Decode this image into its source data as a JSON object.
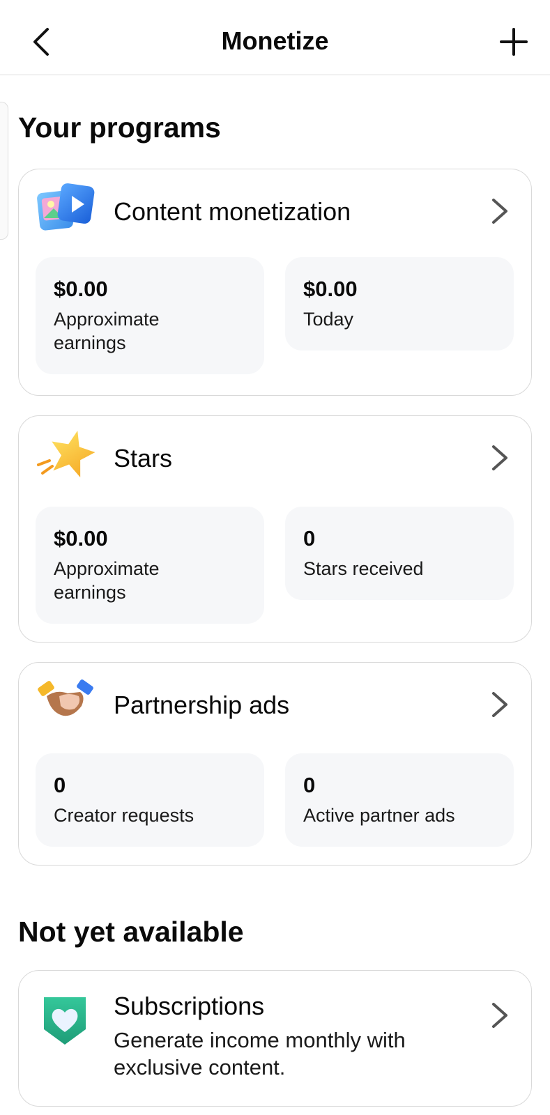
{
  "header": {
    "title": "Monetize"
  },
  "your_programs": {
    "title": "Your programs",
    "cards": [
      {
        "name": "Content monetization",
        "icon": "photo-video-icon",
        "stats": [
          {
            "value": "$0.00",
            "label": "Approximate earnings"
          },
          {
            "value": "$0.00",
            "label": "Today"
          }
        ]
      },
      {
        "name": "Stars",
        "icon": "star-icon",
        "stats": [
          {
            "value": "$0.00",
            "label": "Approximate earnings"
          },
          {
            "value": "0",
            "label": "Stars received"
          }
        ]
      },
      {
        "name": "Partnership ads",
        "icon": "handshake-icon",
        "stats": [
          {
            "value": "0",
            "label": "Creator requests"
          },
          {
            "value": "0",
            "label": "Active partner ads"
          }
        ]
      }
    ]
  },
  "not_yet_available": {
    "title": "Not yet available",
    "subscriptions": {
      "name": "Subscriptions",
      "description": "Generate income monthly with exclusive content.",
      "icon": "heart-shield-icon"
    }
  },
  "colors": {
    "stat_bg": "#f6f7f9",
    "card_border": "#d9d9d9",
    "subscriptions_green": "#2ab38a",
    "star_yellow": "#f7c02b"
  }
}
